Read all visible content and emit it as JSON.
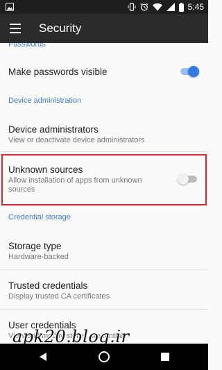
{
  "status_bar": {
    "time": "5:45",
    "icons": [
      "gallery-icon",
      "vibrate-icon",
      "alarm-icon",
      "wifi-icon",
      "signal-icon",
      "battery-icon"
    ]
  },
  "app_bar": {
    "title": "Security",
    "menu_icon": "hamburger-menu-icon"
  },
  "settings": {
    "passwords_header": "Passwords",
    "make_passwords_visible": {
      "title": "Make passwords visible",
      "enabled": true
    },
    "device_admin_header": "Device administration",
    "device_administrators": {
      "title": "Device administrators",
      "subtitle": "View or deactivate device administrators"
    },
    "unknown_sources": {
      "title": "Unknown sources",
      "subtitle_line1": "Allow installation of apps from unknown",
      "subtitle_line2": "sources",
      "enabled": false
    },
    "credential_storage_header": "Credential storage",
    "storage_type": {
      "title": "Storage type",
      "subtitle": "Hardware-backed"
    },
    "trusted_credentials": {
      "title": "Trusted credentials",
      "subtitle": "Display trusted CA certificates"
    },
    "user_credentials": {
      "title": "User credentials",
      "subtitle": "View and modify stored credentials"
    }
  },
  "watermark": "apk20.blog.ir",
  "colors": {
    "accent": "#3d7cc9",
    "toggle_on_thumb": "#2f79e6",
    "toggle_on_track": "#9bbff0",
    "toggle_off_thumb": "#f1f1f1",
    "toggle_off_track": "#bdbdbd",
    "highlight": "#e02230"
  }
}
